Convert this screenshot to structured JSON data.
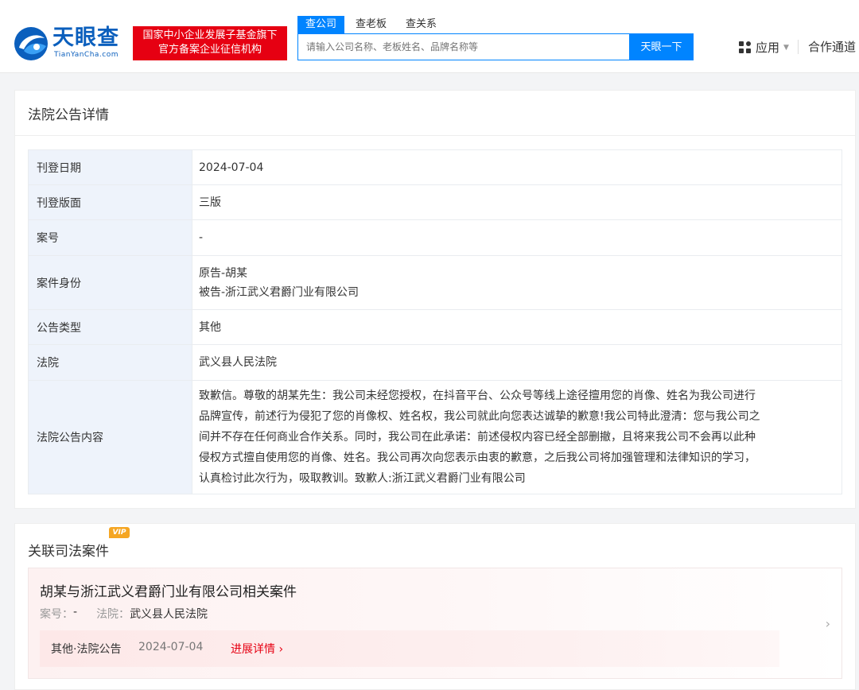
{
  "header": {
    "logo_text": "天眼查",
    "logo_sub": "TianYanCha.com",
    "badge_line1": "国家中小企业发展子基金旗下",
    "badge_line2": "官方备案企业征信机构",
    "tabs": [
      "查公司",
      "查老板",
      "查关系"
    ],
    "search_placeholder": "请输入公司名称、老板姓名、品牌名称等",
    "search_button": "天眼一下",
    "app_label": "应用",
    "partner_label": "合作通道"
  },
  "detail": {
    "title": "法院公告详情",
    "rows": [
      {
        "key": "刊登日期",
        "value": "2024-07-04"
      },
      {
        "key": "刊登版面",
        "value": "三版"
      },
      {
        "key": "案号",
        "value": "-"
      },
      {
        "key": "案件身份",
        "lines": [
          "原告-胡某",
          "被告-浙江武义君爵门业有限公司"
        ]
      },
      {
        "key": "公告类型",
        "value": "其他"
      },
      {
        "key": "法院",
        "value": "武义县人民法院"
      },
      {
        "key": "法院公告内容",
        "lines": [
          "致歉信。尊敬的胡某先生：我公司未经您授权，在抖音平台、公众号等线上途径擅用您的肖像、姓名为我公司进行",
          "品牌宣传，前述行为侵犯了您的肖像权、姓名权，我公司就此向您表达诚挚的歉意!我公司特此澄清：您与我公司之",
          "间并不存在任何商业合作关系。同时，我公司在此承诺：前述侵权内容已经全部删撤，且将来我公司不会再以此种",
          "侵权方式擅自使用您的肖像、姓名。我公司再次向您表示由衷的歉意，之后我公司将加强管理和法律知识的学习，",
          "认真检讨此次行为，吸取教训。致歉人:浙江武义君爵门业有限公司"
        ]
      }
    ]
  },
  "related": {
    "title": "关联司法案件",
    "vip": "VIP",
    "case_title": "胡某与浙江武义君爵门业有限公司相关案件",
    "case_no_label": "案号：",
    "case_no": "-",
    "court_label": "法院：",
    "court": "武义县人民法院",
    "case_type": "其他·法院公告",
    "case_date": "2024-07-04",
    "progress_link": "进展详情",
    "link_chevron": "›",
    "more_chevron": "›"
  },
  "colors": {
    "brand_blue": "#0084ff",
    "badge_red": "#e60012",
    "key_bg": "#eef3fb"
  },
  "icons": [
    "tianyancha-logo-icon",
    "apps-grid-icon",
    "caret-down-icon",
    "chevron-right-icon"
  ]
}
